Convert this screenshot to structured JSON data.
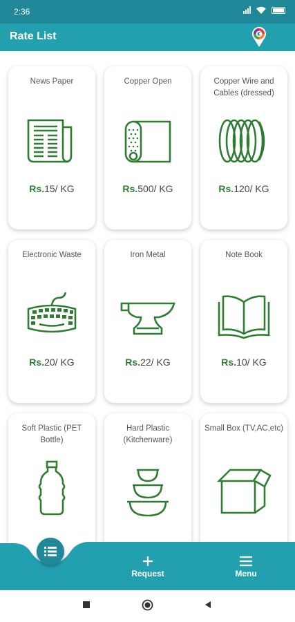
{
  "status_bar": {
    "time": "2:36"
  },
  "app_bar": {
    "title": "Rate List"
  },
  "items": [
    {
      "name": "News Paper",
      "rs": "Rs.",
      "price": "15",
      "unit": "/ KG",
      "icon": "newspaper-icon"
    },
    {
      "name": "Copper Open",
      "rs": "Rs.",
      "price": "500",
      "unit": "/ KG",
      "icon": "copper-sheet-icon"
    },
    {
      "name": "Copper Wire and Cables (dressed)",
      "rs": "Rs.",
      "price": "120",
      "unit": "/ KG",
      "icon": "wire-coil-icon"
    },
    {
      "name": "Electronic Waste",
      "rs": "Rs.",
      "price": "20",
      "unit": "/ KG",
      "icon": "keyboard-icon"
    },
    {
      "name": "Iron Metal",
      "rs": "Rs.",
      "price": "22",
      "unit": "/ KG",
      "icon": "anvil-icon"
    },
    {
      "name": "Note Book",
      "rs": "Rs.",
      "price": "10",
      "unit": "/ KG",
      "icon": "open-book-icon"
    },
    {
      "name": "Soft Plastic (PET Bottle)",
      "rs": "",
      "price": "",
      "unit": "",
      "icon": "bottle-icon"
    },
    {
      "name": "Hard Plastic (Kitchenware)",
      "rs": "",
      "price": "",
      "unit": "",
      "icon": "bowls-icon"
    },
    {
      "name": "Small Box (TV,AC,etc)",
      "rs": "",
      "price": "",
      "unit": "",
      "icon": "box-icon"
    }
  ],
  "bottom_nav": {
    "request_label": "Request",
    "menu_label": "Menu"
  },
  "colors": {
    "primary": "#23a0b0",
    "primary_dark": "#1f8797",
    "icon_green": "#2e7d32"
  }
}
